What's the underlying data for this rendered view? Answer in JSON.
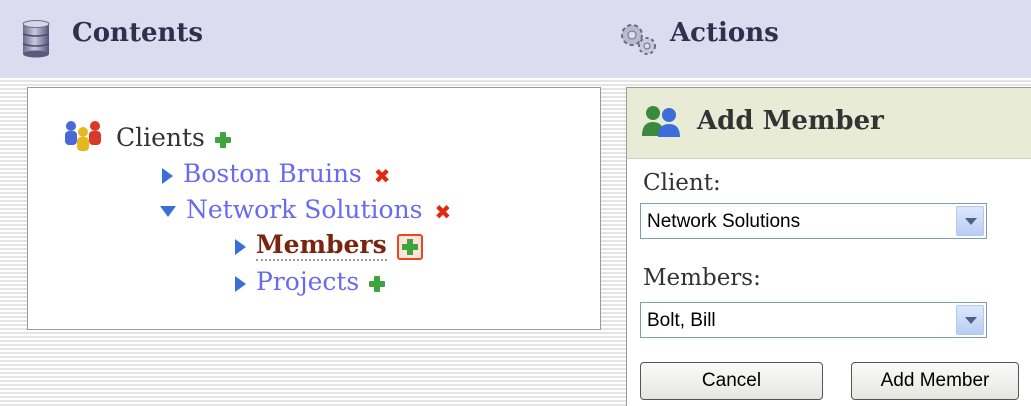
{
  "header": {
    "contents_title": "Contents",
    "actions_title": "Actions"
  },
  "tree": {
    "root_label": "Clients",
    "items": [
      {
        "label": "Boston Bruins",
        "expanded": false,
        "action": "delete"
      },
      {
        "label": "Network Solutions",
        "expanded": true,
        "action": "delete",
        "children": [
          {
            "label": "Members",
            "selected": true,
            "action": "add"
          },
          {
            "label": "Projects",
            "selected": false,
            "action": "add"
          }
        ]
      }
    ]
  },
  "panel": {
    "title": "Add Member",
    "client_label": "Client:",
    "client_value": "Network Solutions",
    "members_label": "Members:",
    "members_value": "Bolt, Bill",
    "cancel_label": "Cancel",
    "submit_label": "Add Member"
  },
  "colors": {
    "header_bg": "#dcdcf0",
    "link": "#6a6aef",
    "selected_node": "#7a2410",
    "add_icon": "#3ea43e",
    "delete_icon": "#e02a10",
    "panel_header_bg": "#e8ecd6"
  },
  "icons": {
    "contents": "database-icon",
    "actions": "gears-icon",
    "clients": "users-group-icon",
    "panel": "add-user-icon",
    "add": "green-plus-icon",
    "delete": "red-x-icon"
  }
}
